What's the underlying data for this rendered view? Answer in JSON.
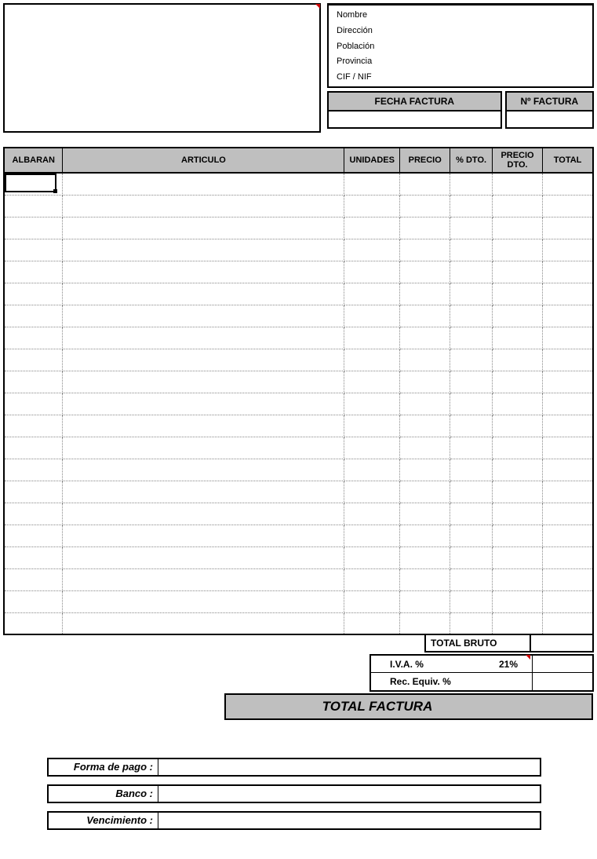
{
  "client": {
    "nombre_label": "Nombre",
    "direccion_label": "Dirección",
    "poblacion_label": "Población",
    "provincia_label": "Provincia",
    "cif_label": "CIF / NIF"
  },
  "meta": {
    "fecha_header": "FECHA FACTURA",
    "num_header": "Nº FACTURA",
    "fecha_value": "",
    "num_value": ""
  },
  "cols": {
    "albaran": "ALBARAN",
    "articulo": "ARTICULO",
    "unidades": "UNIDADES",
    "precio": "PRECIO",
    "dto": "% DTO.",
    "precio_dto": "PRECIO DTO.",
    "total": "TOTAL"
  },
  "row_count": 21,
  "totals": {
    "bruto_label": "TOTAL BRUTO",
    "bruto_value": "",
    "iva_label": "I.V.A. %",
    "iva_pct": "21%",
    "iva_value": "",
    "rec_label": "Rec. Equiv. %",
    "rec_pct": "",
    "rec_value": "",
    "total_factura_label": "TOTAL FACTURA",
    "total_factura_value": ""
  },
  "footer": {
    "forma_label": "Forma de pago :",
    "forma_value": "",
    "banco_label": "Banco :",
    "banco_value": "",
    "venc_label": "Vencimiento :",
    "venc_value": ""
  }
}
